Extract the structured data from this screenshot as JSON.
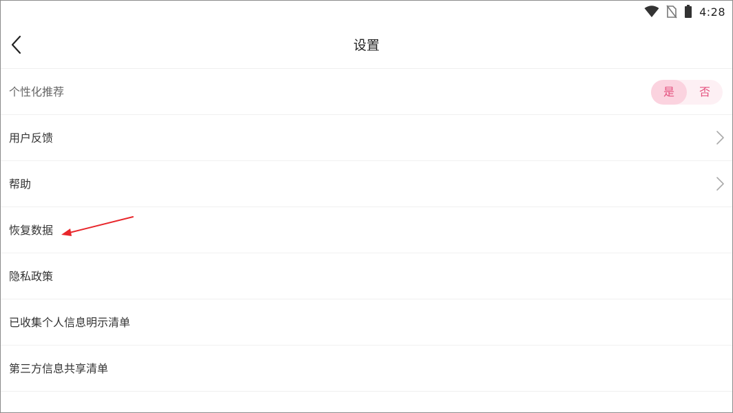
{
  "status_bar": {
    "time": "4:28",
    "icons": [
      "wifi-icon",
      "no-sim-icon",
      "battery-icon"
    ]
  },
  "header": {
    "title": "设置",
    "back_icon": "chevron-left-icon"
  },
  "settings": {
    "personalized": {
      "label": "个性化推荐",
      "options": [
        "是",
        "否"
      ],
      "selected": "是"
    },
    "items": [
      {
        "label": "用户反馈",
        "has_chevron": true
      },
      {
        "label": "帮助",
        "has_chevron": true
      },
      {
        "label": "恢复数据",
        "has_chevron": false
      },
      {
        "label": "隐私政策",
        "has_chevron": false
      },
      {
        "label": "已收集个人信息明示清单",
        "has_chevron": false
      },
      {
        "label": "第三方信息共享清单",
        "has_chevron": false
      }
    ]
  },
  "colors": {
    "accent": "#e4507e",
    "toggle_bg": "#fdf0f4",
    "toggle_active": "#fbd3df",
    "annotation": "#e8262b"
  }
}
